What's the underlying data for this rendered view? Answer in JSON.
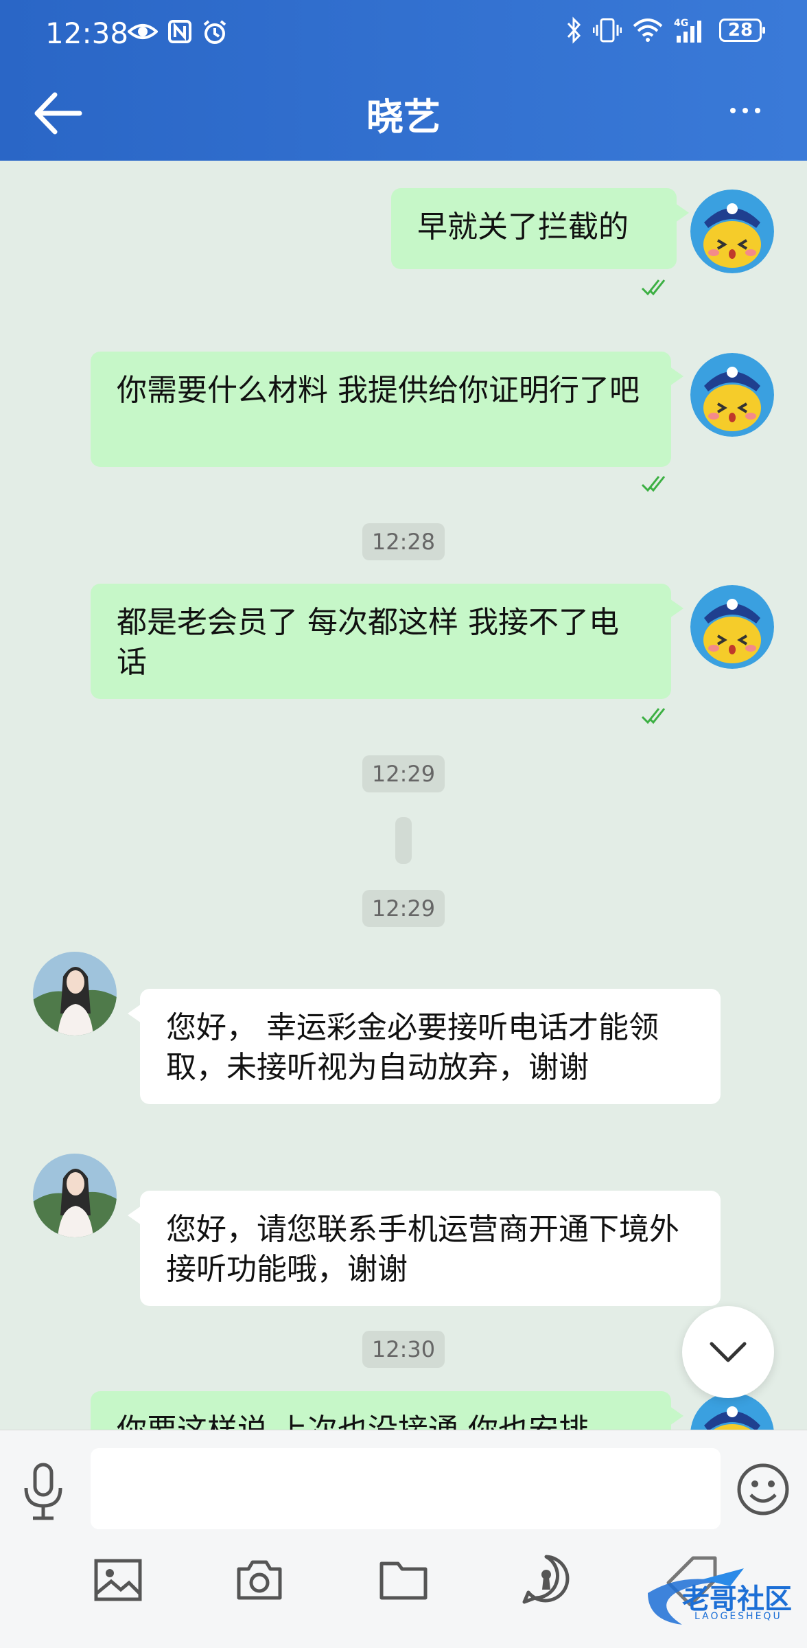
{
  "status_bar": {
    "time": "12:38",
    "battery": "28"
  },
  "header": {
    "title": "晓艺"
  },
  "messages": [
    {
      "text": "早就关了拦截的"
    },
    {
      "text": "你需要什么材料  我提供给你证明行了吧"
    },
    {
      "time": "12:28"
    },
    {
      "text": "都是老会员了   每次都这样   我接不了电话"
    },
    {
      "time": "12:29"
    },
    {
      "time": "12:29"
    },
    {
      "text": "您好， 幸运彩金必要接听电话才能领取，未接听视为自动放弃，谢谢"
    },
    {
      "text": "您好，请您联系手机运营商开通下境外接听功能哦，谢谢"
    },
    {
      "time": "12:30"
    },
    {
      "text": "你要这样说  上次也没接通  你也安排"
    }
  ],
  "input": {
    "placeholder": ""
  },
  "watermark": {
    "text": "老哥社区",
    "sub": "LAOGESHEQU"
  },
  "colors": {
    "header": "#2a66c6",
    "chat_bg": "#e3ede6",
    "outgoing_bubble": "#c6f7c8",
    "incoming_bubble": "#ffffff",
    "read_check": "#3cb043"
  }
}
